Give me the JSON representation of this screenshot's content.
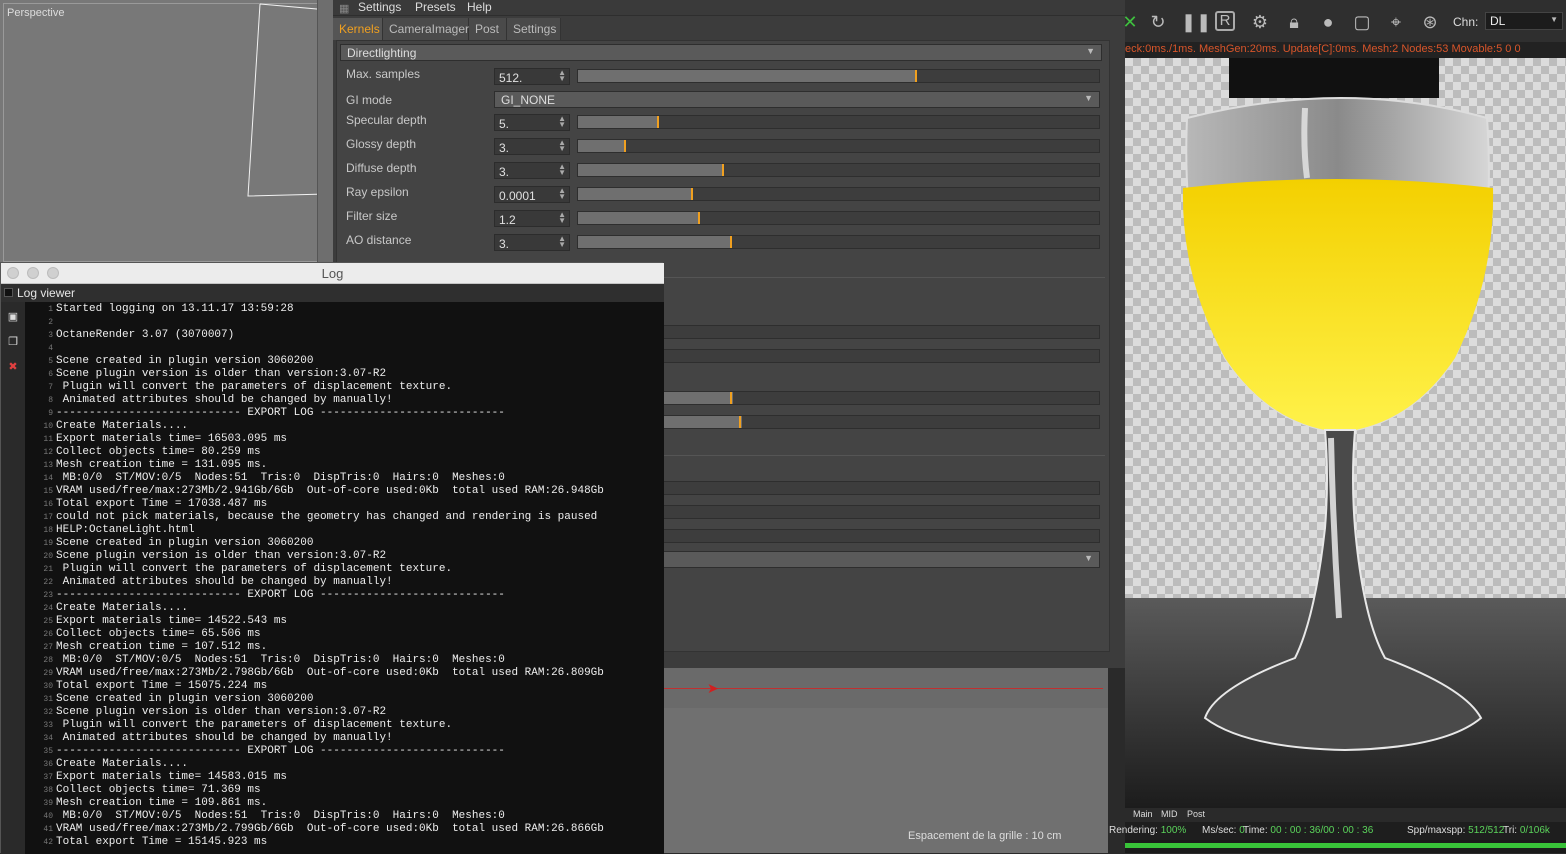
{
  "viewport": {
    "label": "Perspective"
  },
  "settings": {
    "menu": [
      "Settings",
      "Presets",
      "Help"
    ],
    "tabs": [
      "Kernels",
      "CameraImager",
      "Post",
      "Settings"
    ],
    "active_tab": "Kernels",
    "kernel": "Directlighting",
    "params": [
      {
        "label": "Max. samples",
        "value": "512.",
        "fill": 0.65
      },
      {
        "label": "GI mode",
        "value": "GI_NONE",
        "type": "dropdown"
      },
      {
        "label": "Specular depth",
        "value": "5.",
        "fill": 0.155
      },
      {
        "label": "Glossy depth",
        "value": "3.",
        "fill": 0.092
      },
      {
        "label": "Diffuse depth",
        "value": "3.",
        "fill": 0.28
      },
      {
        "label": "Ray epsilon",
        "value": "0.0001",
        "fill": 0.22
      },
      {
        "label": "Filter size",
        "value": "1.2",
        "fill": 0.235
      },
      {
        "label": "AO distance",
        "value": "3.",
        "fill": 0.295
      }
    ],
    "colors": {
      "accent": "#f0a020"
    }
  },
  "bottom": {
    "grid_label": "Espacement de la grille : 10 cm"
  },
  "log": {
    "window_title": "Log",
    "viewer_title": "Log viewer",
    "toolbar_icons": [
      "save-icon",
      "copy-icon",
      "clear-icon"
    ],
    "lines": [
      "Started logging on 13.11.17 13:59:28",
      "",
      "OctaneRender 3.07 (3070007)",
      "",
      "Scene created in plugin version 3060200",
      "Scene plugin version is older than version:3.07-R2",
      " Plugin will convert the parameters of displacement texture.",
      " Animated attributes should be changed by manually!",
      "---------------------------- EXPORT LOG ----------------------------",
      "Create Materials....",
      "Export materials time= 16503.095 ms",
      "Collect objects time= 80.259 ms",
      "Mesh creation time = 131.095 ms.",
      " MB:0/0  ST/MOV:0/5  Nodes:51  Tris:0  DispTris:0  Hairs:0  Meshes:0",
      "VRAM used/free/max:273Mb/2.941Gb/6Gb  Out-of-core used:0Kb  total used RAM:26.948Gb",
      "Total export Time = 17038.487 ms",
      "could not pick materials, because the geometry has changed and rendering is paused",
      "HELP:OctaneLight.html",
      "Scene created in plugin version 3060200",
      "Scene plugin version is older than version:3.07-R2",
      " Plugin will convert the parameters of displacement texture.",
      " Animated attributes should be changed by manually!",
      "---------------------------- EXPORT LOG ----------------------------",
      "Create Materials....",
      "Export materials time= 14522.543 ms",
      "Collect objects time= 65.506 ms",
      "Mesh creation time = 107.512 ms.",
      " MB:0/0  ST/MOV:0/5  Nodes:51  Tris:0  DispTris:0  Hairs:0  Meshes:0",
      "VRAM used/free/max:273Mb/2.798Gb/6Gb  Out-of-core used:0Kb  total used RAM:26.809Gb",
      "Total export Time = 15075.224 ms",
      "Scene created in plugin version 3060200",
      "Scene plugin version is older than version:3.07-R2",
      " Plugin will convert the parameters of displacement texture.",
      " Animated attributes should be changed by manually!",
      "---------------------------- EXPORT LOG ----------------------------",
      "Create Materials....",
      "Export materials time= 14583.015 ms",
      "Collect objects time= 71.369 ms",
      "Mesh creation time = 109.861 ms.",
      " MB:0/0  ST/MOV:0/5  Nodes:51  Tris:0  DispTris:0  Hairs:0  Meshes:0",
      "VRAM used/free/max:273Mb/2.799Gb/6Gb  Out-of-core used:0Kb  total used RAM:26.866Gb",
      "Total export Time = 15145.923 ms"
    ]
  },
  "render": {
    "toolbar_icons": [
      "send-icon",
      "restart-icon",
      "pause-icon",
      "region-icon",
      "gear-icon",
      "lock-icon",
      "sphere-icon",
      "frame-icon",
      "pin-focus-icon",
      "pin-material-icon"
    ],
    "chn_label": "Chn:",
    "chn_value": "DL",
    "stats": "eck:0ms./1ms. MeshGen:20ms. Update[C]:0ms. Mesh:2 Nodes:53 Movable:5  0 0",
    "tabs": [
      "Main",
      "MID",
      "Post"
    ],
    "status": {
      "rendering_label": "Rendering:",
      "rendering_value": "100%",
      "mssec_label": "Ms/sec:",
      "mssec_value": "0",
      "time_label": "Time:",
      "time_value": "00 : 00 : 36/00 : 00 : 36",
      "spp_label": "Spp/maxspp:",
      "spp_value": "512/512",
      "tri_label": "Tri:",
      "tri_value": "0/106k"
    },
    "progress": 1.0
  }
}
